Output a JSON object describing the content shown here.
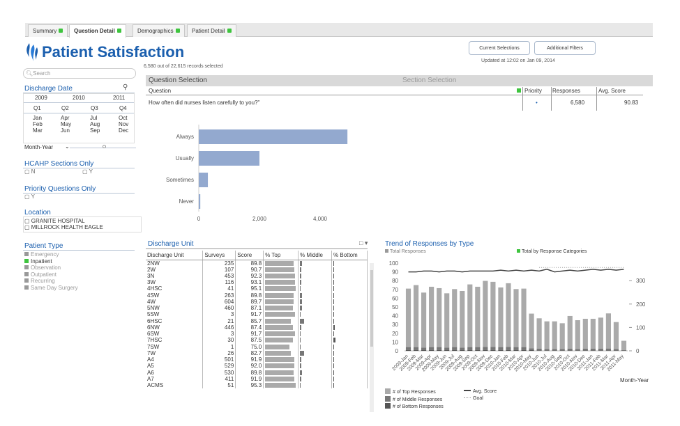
{
  "tabs": [
    {
      "label": "Summary"
    },
    {
      "label": "Question Detail"
    },
    {
      "label": "Demographics"
    },
    {
      "label": "Patient Detail"
    }
  ],
  "header": {
    "title": "Patient Satisfaction",
    "records": "6,580 out of 22,615 records selected",
    "current_selections": "Current Selections",
    "additional_filters": "Additional Filters",
    "updated": "Updated at 12:02 on Jan 09, 2014"
  },
  "sidebar": {
    "search_placeholder": "Search",
    "discharge_date": {
      "title": "Discharge Date",
      "years": [
        "2009",
        "2010",
        "2011"
      ],
      "quarters": [
        "Q1",
        "Q2",
        "Q3",
        "Q4"
      ],
      "months": [
        [
          "Jan",
          "Feb",
          "Mar"
        ],
        [
          "Apr",
          "May",
          "Jun"
        ],
        [
          "Jul",
          "Aug",
          "Sep"
        ],
        [
          "Oct",
          "Nov",
          "Dec"
        ]
      ],
      "month_year_label": "Month-Year"
    },
    "hcahp": {
      "title": "HCAHP Sections Only",
      "options": [
        "N",
        "Y"
      ]
    },
    "priority": {
      "title": "Priority Questions Only",
      "options": [
        "Y"
      ]
    },
    "location": {
      "title": "Location",
      "items": [
        "GRANITE HOSPITAL",
        "MILLROCK HEALTH EAGLE"
      ]
    },
    "patient_type": {
      "title": "Patient Type",
      "items": [
        {
          "label": "Emergency",
          "selected": false
        },
        {
          "label": "Inpatient",
          "selected": true
        },
        {
          "label": "Observation",
          "selected": false
        },
        {
          "label": "Outpatient",
          "selected": false
        },
        {
          "label": "Recurring",
          "selected": false
        },
        {
          "label": "Same Day Surgery",
          "selected": false
        }
      ]
    }
  },
  "question": {
    "question_selection": "Question Selection",
    "section_selection": "Section Selection",
    "col_question": "Question",
    "col_priority": "Priority",
    "col_responses": "Responses",
    "col_avg": "Avg. Score",
    "row": {
      "question": "How often did nurses listen carefully to you?\"",
      "priority": "•",
      "responses": "6,580",
      "avg": "90.83"
    }
  },
  "chart_data": [
    {
      "type": "bar",
      "orientation": "horizontal",
      "categories": [
        "Always",
        "Usually",
        "Sometimes",
        "Never"
      ],
      "values": [
        4900,
        2000,
        300,
        50
      ],
      "xticks": [
        "0",
        "2,000",
        "4,000"
      ],
      "xlim": [
        0,
        4000
      ]
    },
    {
      "type": "bar+line",
      "title": "Trend of Responses by Type",
      "legend_toggle_left": "Total Responses",
      "legend_toggle_right": "Total by Response Categories",
      "xlabel": "Month-Year",
      "y_left_ticks": [
        "0",
        "10",
        "20",
        "30",
        "40",
        "50",
        "60",
        "70",
        "80",
        "90",
        "100"
      ],
      "y_right_ticks": [
        "0",
        "100",
        "200",
        "300"
      ],
      "categories": [
        "2009-Jan",
        "2009-Feb",
        "2009-Mar",
        "2009-Apr",
        "2009-May",
        "2009-Jun",
        "2009-Jul",
        "2009-Aug",
        "2009-Sep",
        "2009-Oct",
        "2009-Nov",
        "2009-Dec",
        "2010-Jan",
        "2010-Feb",
        "2010-Mar",
        "2010-Apr",
        "2010-May",
        "2010-Jun",
        "2010-Jul",
        "2010-Aug",
        "2010-Sep",
        "2010-Oct",
        "2010-Nov",
        "2010-Dec",
        "2011-Jan",
        "2011-Feb",
        "2011-Mar",
        "2011-Apr",
        "2011-May"
      ],
      "tick_labels": [
        "2009-Jan",
        "2009-Feb",
        "2009-Mar",
        "2009-Apr",
        "2009-May",
        "2009-Jun",
        "2009-Jul",
        "2009-Aug",
        "2009-Sep",
        "2009-Oct",
        "2009-Nov",
        "2009-Dec",
        "2010-Jan",
        "2010-Feb",
        "2010-Mar",
        "2010-Apr",
        "2010-May",
        "2010-Jun",
        "2010-Jul",
        "2010-Aug",
        "2010-Sep",
        "2010-Oct",
        "2010-Nov",
        "2010-Dec",
        "2011-Jan",
        "2011-Feb",
        "2011-Mar",
        "2011-Apr",
        "2011-May"
      ],
      "series": [
        {
          "name": "# of Top Responses",
          "color": "#aaaaaa",
          "values": [
            250,
            265,
            235,
            258,
            252,
            232,
            248,
            242,
            268,
            258,
            282,
            278,
            255,
            272,
            248,
            250,
            148,
            130,
            118,
            118,
            110,
            140,
            123,
            128,
            128,
            133,
            150,
            115,
            40
          ]
        },
        {
          "name": "# of Middle Responses",
          "color": "#777777",
          "values": [
            12,
            12,
            11,
            12,
            12,
            11,
            12,
            11,
            12,
            12,
            13,
            13,
            12,
            13,
            12,
            12,
            8,
            7,
            6,
            6,
            6,
            7,
            6,
            7,
            7,
            7,
            8,
            6,
            2
          ]
        },
        {
          "name": "# of Bottom Responses",
          "color": "#555555",
          "values": [
            4,
            4,
            3,
            4,
            4,
            3,
            4,
            3,
            4,
            4,
            4,
            4,
            4,
            4,
            4,
            4,
            3,
            2,
            2,
            2,
            2,
            2,
            2,
            2,
            2,
            2,
            2,
            2,
            1
          ]
        },
        {
          "name": "Avg. Score",
          "color": "#444444",
          "values": [
            90,
            90,
            91,
            91,
            90,
            91,
            91,
            90,
            91,
            91,
            91,
            91,
            92,
            91,
            92,
            91,
            92,
            91,
            93,
            90,
            91,
            92,
            91,
            92,
            93,
            92,
            93,
            92,
            93
          ]
        },
        {
          "name": "Goal",
          "color": "#999999",
          "values": [
            95,
            95,
            95,
            95,
            95,
            95,
            95,
            95,
            95,
            95,
            95,
            95,
            95,
            95,
            95,
            95,
            95,
            95,
            95,
            95,
            95,
            95,
            95,
            95,
            95,
            95,
            95,
            95,
            95
          ]
        }
      ],
      "legend": [
        "# of Top Responses",
        "# of Middle Responses",
        "# of Bottom Responses",
        "Avg. Score",
        "Goal"
      ]
    }
  ],
  "discharge_unit": {
    "title": "Discharge Unit",
    "columns": [
      "Discharge Unit",
      "Surveys",
      "Score",
      "% Top",
      "% Middle",
      "% Bottom"
    ],
    "rows": [
      {
        "unit": "2NW",
        "surveys": "235",
        "score": "89.8",
        "top": 0.89,
        "mid": 0.06,
        "bot": 0.02
      },
      {
        "unit": "2W",
        "surveys": "107",
        "score": "90.7",
        "top": 0.9,
        "mid": 0.05,
        "bot": 0.02
      },
      {
        "unit": "3N",
        "surveys": "453",
        "score": "92.3",
        "top": 0.92,
        "mid": 0.05,
        "bot": 0.01
      },
      {
        "unit": "3W",
        "surveys": "116",
        "score": "93.1",
        "top": 0.93,
        "mid": 0.04,
        "bot": 0.01
      },
      {
        "unit": "4HSC",
        "surveys": "41",
        "score": "95.1",
        "top": 0.95,
        "mid": 0.03,
        "bot": 0.0
      },
      {
        "unit": "4SW",
        "surveys": "263",
        "score": "89.8",
        "top": 0.89,
        "mid": 0.06,
        "bot": 0.02
      },
      {
        "unit": "4W",
        "surveys": "604",
        "score": "89.7",
        "top": 0.89,
        "mid": 0.06,
        "bot": 0.02
      },
      {
        "unit": "5NW",
        "surveys": "460",
        "score": "87.1",
        "top": 0.87,
        "mid": 0.06,
        "bot": 0.03
      },
      {
        "unit": "5SW",
        "surveys": "3",
        "score": "91.7",
        "top": 0.92,
        "mid": 0.0,
        "bot": 0.0
      },
      {
        "unit": "6HSC",
        "surveys": "21",
        "score": "85.7",
        "top": 0.81,
        "mid": 0.14,
        "bot": 0.0
      },
      {
        "unit": "6NW",
        "surveys": "446",
        "score": "87.4",
        "top": 0.87,
        "mid": 0.05,
        "bot": 0.04
      },
      {
        "unit": "6SW",
        "surveys": "3",
        "score": "91.7",
        "top": 0.92,
        "mid": 0.0,
        "bot": 0.0
      },
      {
        "unit": "7HSC",
        "surveys": "30",
        "score": "87.5",
        "top": 0.87,
        "mid": 0.03,
        "bot": 0.06
      },
      {
        "unit": "7SW",
        "surveys": "1",
        "score": "75.0",
        "top": 0.75,
        "mid": 0.0,
        "bot": 0.0
      },
      {
        "unit": "7W",
        "surveys": "26",
        "score": "82.7",
        "top": 0.8,
        "mid": 0.14,
        "bot": 0.0
      },
      {
        "unit": "A4",
        "surveys": "501",
        "score": "91.9",
        "top": 0.91,
        "mid": 0.05,
        "bot": 0.02
      },
      {
        "unit": "A5",
        "surveys": "529",
        "score": "92.0",
        "top": 0.91,
        "mid": 0.05,
        "bot": 0.02
      },
      {
        "unit": "A6",
        "surveys": "530",
        "score": "89.8",
        "top": 0.89,
        "mid": 0.06,
        "bot": 0.02
      },
      {
        "unit": "A7",
        "surveys": "411",
        "score": "91.9",
        "top": 0.91,
        "mid": 0.05,
        "bot": 0.02
      },
      {
        "unit": "ACMS",
        "surveys": "51",
        "score": "95.3",
        "top": 0.95,
        "mid": 0.03,
        "bot": 0.0
      }
    ]
  }
}
